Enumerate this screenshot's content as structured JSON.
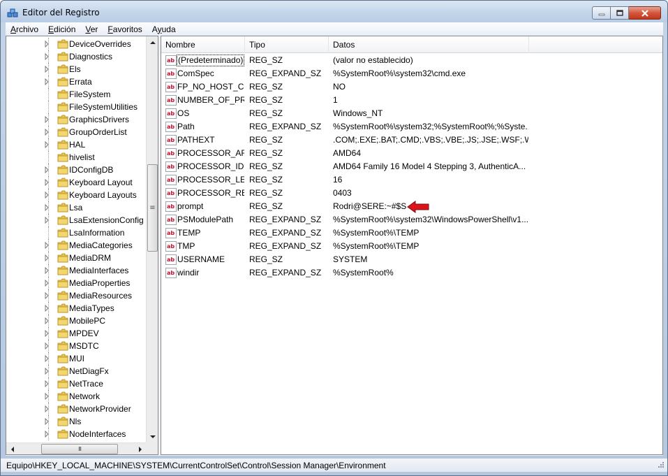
{
  "window": {
    "title": "Editor del Registro"
  },
  "menu": [
    {
      "label": "Archivo",
      "key": "A",
      "rest": "rchivo"
    },
    {
      "label": "Edición",
      "key": "E",
      "rest": "dición"
    },
    {
      "label": "Ver",
      "key": "V",
      "rest": "er"
    },
    {
      "label": "Favoritos",
      "key": "F",
      "rest": "avoritos"
    },
    {
      "label": "Ayuda",
      "key": "y",
      "pre": "A",
      "rest": "uda"
    }
  ],
  "tree": {
    "items": [
      {
        "label": "DeviceOverrides",
        "expandable": true
      },
      {
        "label": "Diagnostics",
        "expandable": true
      },
      {
        "label": "Els",
        "expandable": true
      },
      {
        "label": "Errata",
        "expandable": true
      },
      {
        "label": "FileSystem",
        "expandable": false
      },
      {
        "label": "FileSystemUtilities",
        "expandable": false
      },
      {
        "label": "GraphicsDrivers",
        "expandable": true
      },
      {
        "label": "GroupOrderList",
        "expandable": true
      },
      {
        "label": "HAL",
        "expandable": true
      },
      {
        "label": "hivelist",
        "expandable": false
      },
      {
        "label": "IDConfigDB",
        "expandable": true
      },
      {
        "label": "Keyboard Layout",
        "expandable": true
      },
      {
        "label": "Keyboard Layouts",
        "expandable": true
      },
      {
        "label": "Lsa",
        "expandable": true
      },
      {
        "label": "LsaExtensionConfig",
        "expandable": true
      },
      {
        "label": "LsaInformation",
        "expandable": false
      },
      {
        "label": "MediaCategories",
        "expandable": true
      },
      {
        "label": "MediaDRM",
        "expandable": true
      },
      {
        "label": "MediaInterfaces",
        "expandable": true
      },
      {
        "label": "MediaProperties",
        "expandable": true
      },
      {
        "label": "MediaResources",
        "expandable": true
      },
      {
        "label": "MediaTypes",
        "expandable": true
      },
      {
        "label": "MobilePC",
        "expandable": true
      },
      {
        "label": "MPDEV",
        "expandable": true
      },
      {
        "label": "MSDTC",
        "expandable": true
      },
      {
        "label": "MUI",
        "expandable": true
      },
      {
        "label": "NetDiagFx",
        "expandable": true
      },
      {
        "label": "NetTrace",
        "expandable": true
      },
      {
        "label": "Network",
        "expandable": true
      },
      {
        "label": "NetworkProvider",
        "expandable": true
      },
      {
        "label": "Nls",
        "expandable": true
      },
      {
        "label": "NodeInterfaces",
        "expandable": true
      }
    ],
    "scrollbar_thumb_glyph": "≡",
    "hscroll_thumb_glyph": "III"
  },
  "values": {
    "columns": [
      "Nombre",
      "Tipo",
      "Datos",
      ""
    ],
    "rows": [
      {
        "name": "(Predeterminado)",
        "type": "REG_SZ",
        "data": "(valor no establecido)",
        "selected": true
      },
      {
        "name": "ComSpec",
        "type": "REG_EXPAND_SZ",
        "data": "%SystemRoot%\\system32\\cmd.exe"
      },
      {
        "name": "FP_NO_HOST_C...",
        "type": "REG_SZ",
        "data": "NO"
      },
      {
        "name": "NUMBER_OF_PR...",
        "type": "REG_SZ",
        "data": "1"
      },
      {
        "name": "OS",
        "type": "REG_SZ",
        "data": "Windows_NT"
      },
      {
        "name": "Path",
        "type": "REG_EXPAND_SZ",
        "data": "%SystemRoot%\\system32;%SystemRoot%;%Syste..."
      },
      {
        "name": "PATHEXT",
        "type": "REG_SZ",
        "data": ".COM;.EXE;.BAT;.CMD;.VBS;.VBE;.JS;.JSE;.WSF;.WS..."
      },
      {
        "name": "PROCESSOR_AR...",
        "type": "REG_SZ",
        "data": "AMD64"
      },
      {
        "name": "PROCESSOR_IDE...",
        "type": "REG_SZ",
        "data": "AMD64 Family 16 Model 4 Stepping 3, AuthenticA..."
      },
      {
        "name": "PROCESSOR_LE...",
        "type": "REG_SZ",
        "data": "16"
      },
      {
        "name": "PROCESSOR_RE...",
        "type": "REG_SZ",
        "data": "0403"
      },
      {
        "name": "prompt",
        "type": "REG_SZ",
        "data": "Rodri@SERE:~#$S",
        "highlight_arrow": true
      },
      {
        "name": "PSModulePath",
        "type": "REG_EXPAND_SZ",
        "data": "%SystemRoot%\\system32\\WindowsPowerShell\\v1..."
      },
      {
        "name": "TEMP",
        "type": "REG_EXPAND_SZ",
        "data": "%SystemRoot%\\TEMP"
      },
      {
        "name": "TMP",
        "type": "REG_EXPAND_SZ",
        "data": "%SystemRoot%\\TEMP"
      },
      {
        "name": "USERNAME",
        "type": "REG_SZ",
        "data": "SYSTEM"
      },
      {
        "name": "windir",
        "type": "REG_EXPAND_SZ",
        "data": "%SystemRoot%"
      }
    ],
    "icon_glyph": "ab"
  },
  "status": {
    "path": "Equipo\\HKEY_LOCAL_MACHINE\\SYSTEM\\CurrentControlSet\\Control\\Session Manager\\Environment"
  },
  "colors": {
    "folder": "#e8c24a",
    "arrow": "#d9141b",
    "ab_red": "#c8102e"
  }
}
